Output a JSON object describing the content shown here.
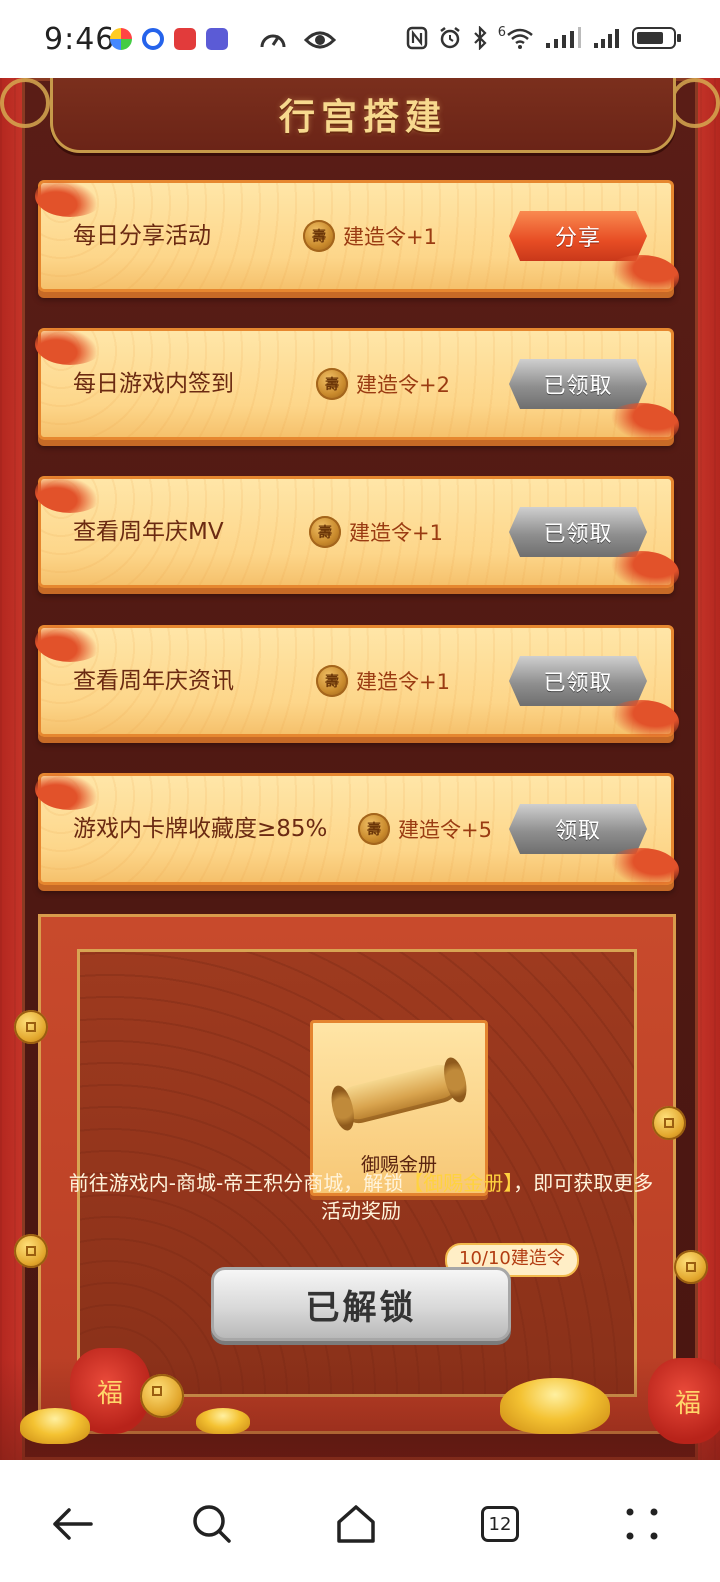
{
  "status_bar": {
    "time": "9:46",
    "signal_label": "6",
    "battery_level": 0.75,
    "icons": [
      "color-wheel-icon",
      "circle-app-icon",
      "red-app-icon",
      "tie-app-icon",
      "speedometer-icon",
      "eye-icon",
      "nfc-icon",
      "alarm-icon",
      "bluetooth-icon",
      "wifi-icon",
      "signal-icon",
      "signal-icon",
      "battery-icon"
    ]
  },
  "page": {
    "title": "行宫搭建"
  },
  "tasks": [
    {
      "name": "每日分享活动",
      "reward": "建造令+1",
      "button": "分享",
      "state": "active"
    },
    {
      "name": "每日游戏内签到",
      "reward": "建造令+2",
      "button": "已领取",
      "state": "claimed"
    },
    {
      "name": "查看周年庆MV",
      "reward": "建造令+1",
      "button": "已领取",
      "state": "claimed"
    },
    {
      "name": "查看周年庆资讯",
      "reward": "建造令+1",
      "button": "已领取",
      "state": "claimed"
    },
    {
      "name": "游戏内卡牌收藏度≥85%",
      "reward": "建造令+5",
      "button": "领取",
      "state": "claimable"
    }
  ],
  "coin_glyph": "壽",
  "reward_panel": {
    "item_name": "御赐金册",
    "desc_prefix": "前往游戏内-商城-帝王积分商城，解锁",
    "desc_highlight": "【御赐金册】",
    "desc_suffix": "，即可获取更多活动奖励",
    "unlock_button": "已解锁",
    "progress_badge": "10/10建造令"
  },
  "deco": {
    "bag_glyph": "福"
  },
  "nav_bar": {
    "tab_count": "12",
    "icons": [
      "back-arrow-icon",
      "search-icon",
      "home-icon",
      "tabs-icon",
      "menu-dots-icon"
    ]
  },
  "colors": {
    "accent_red": "#e74d24",
    "gold": "#f7d98e",
    "highlight_yellow": "#ffd23f"
  }
}
